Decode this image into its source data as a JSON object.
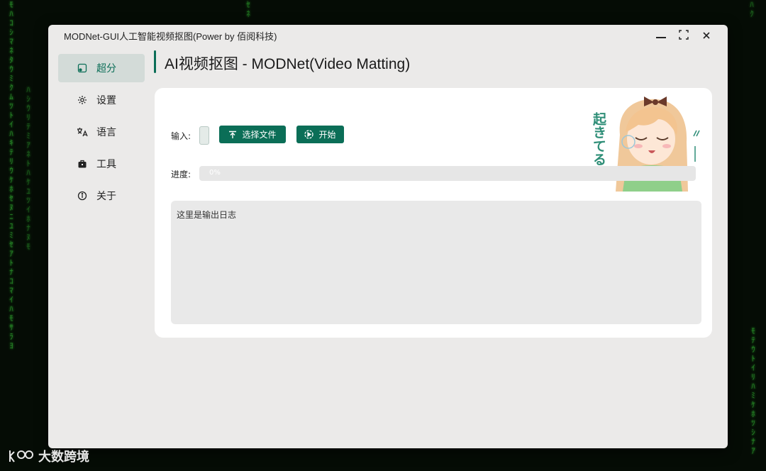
{
  "window": {
    "title": "MODNet-GUI人工智能视频抠图(Power by 佰阅科技)",
    "controls": {
      "minimize": "minimize-icon",
      "maximize": "maximize-icon",
      "close": "close-icon"
    }
  },
  "sidebar": {
    "items": [
      {
        "label": "超分",
        "icon": "image-icon",
        "active": true
      },
      {
        "label": "设置",
        "icon": "gear-icon",
        "active": false
      },
      {
        "label": "语言",
        "icon": "translate-icon",
        "active": false
      },
      {
        "label": "工具",
        "icon": "toolbox-icon",
        "active": false
      },
      {
        "label": "关于",
        "icon": "info-icon",
        "active": false
      }
    ]
  },
  "page": {
    "title": "AI视频抠图 - MODNet(Video Matting)"
  },
  "form": {
    "input_label": "输入:",
    "input_value": "",
    "choose_file_label": "选择文件",
    "start_label": "开始",
    "progress_label": "进度:",
    "progress_text": "0%",
    "progress_fraction": 0.0,
    "log_text": "这里是输出日志"
  },
  "mascot": {
    "caption": "起きてる"
  },
  "watermark": {
    "text": "大数跨境"
  },
  "colors": {
    "accent": "#0b6e57",
    "window_bg": "#ebeae9",
    "card_bg": "#ffffff",
    "log_bg": "#e9e9e9"
  }
}
